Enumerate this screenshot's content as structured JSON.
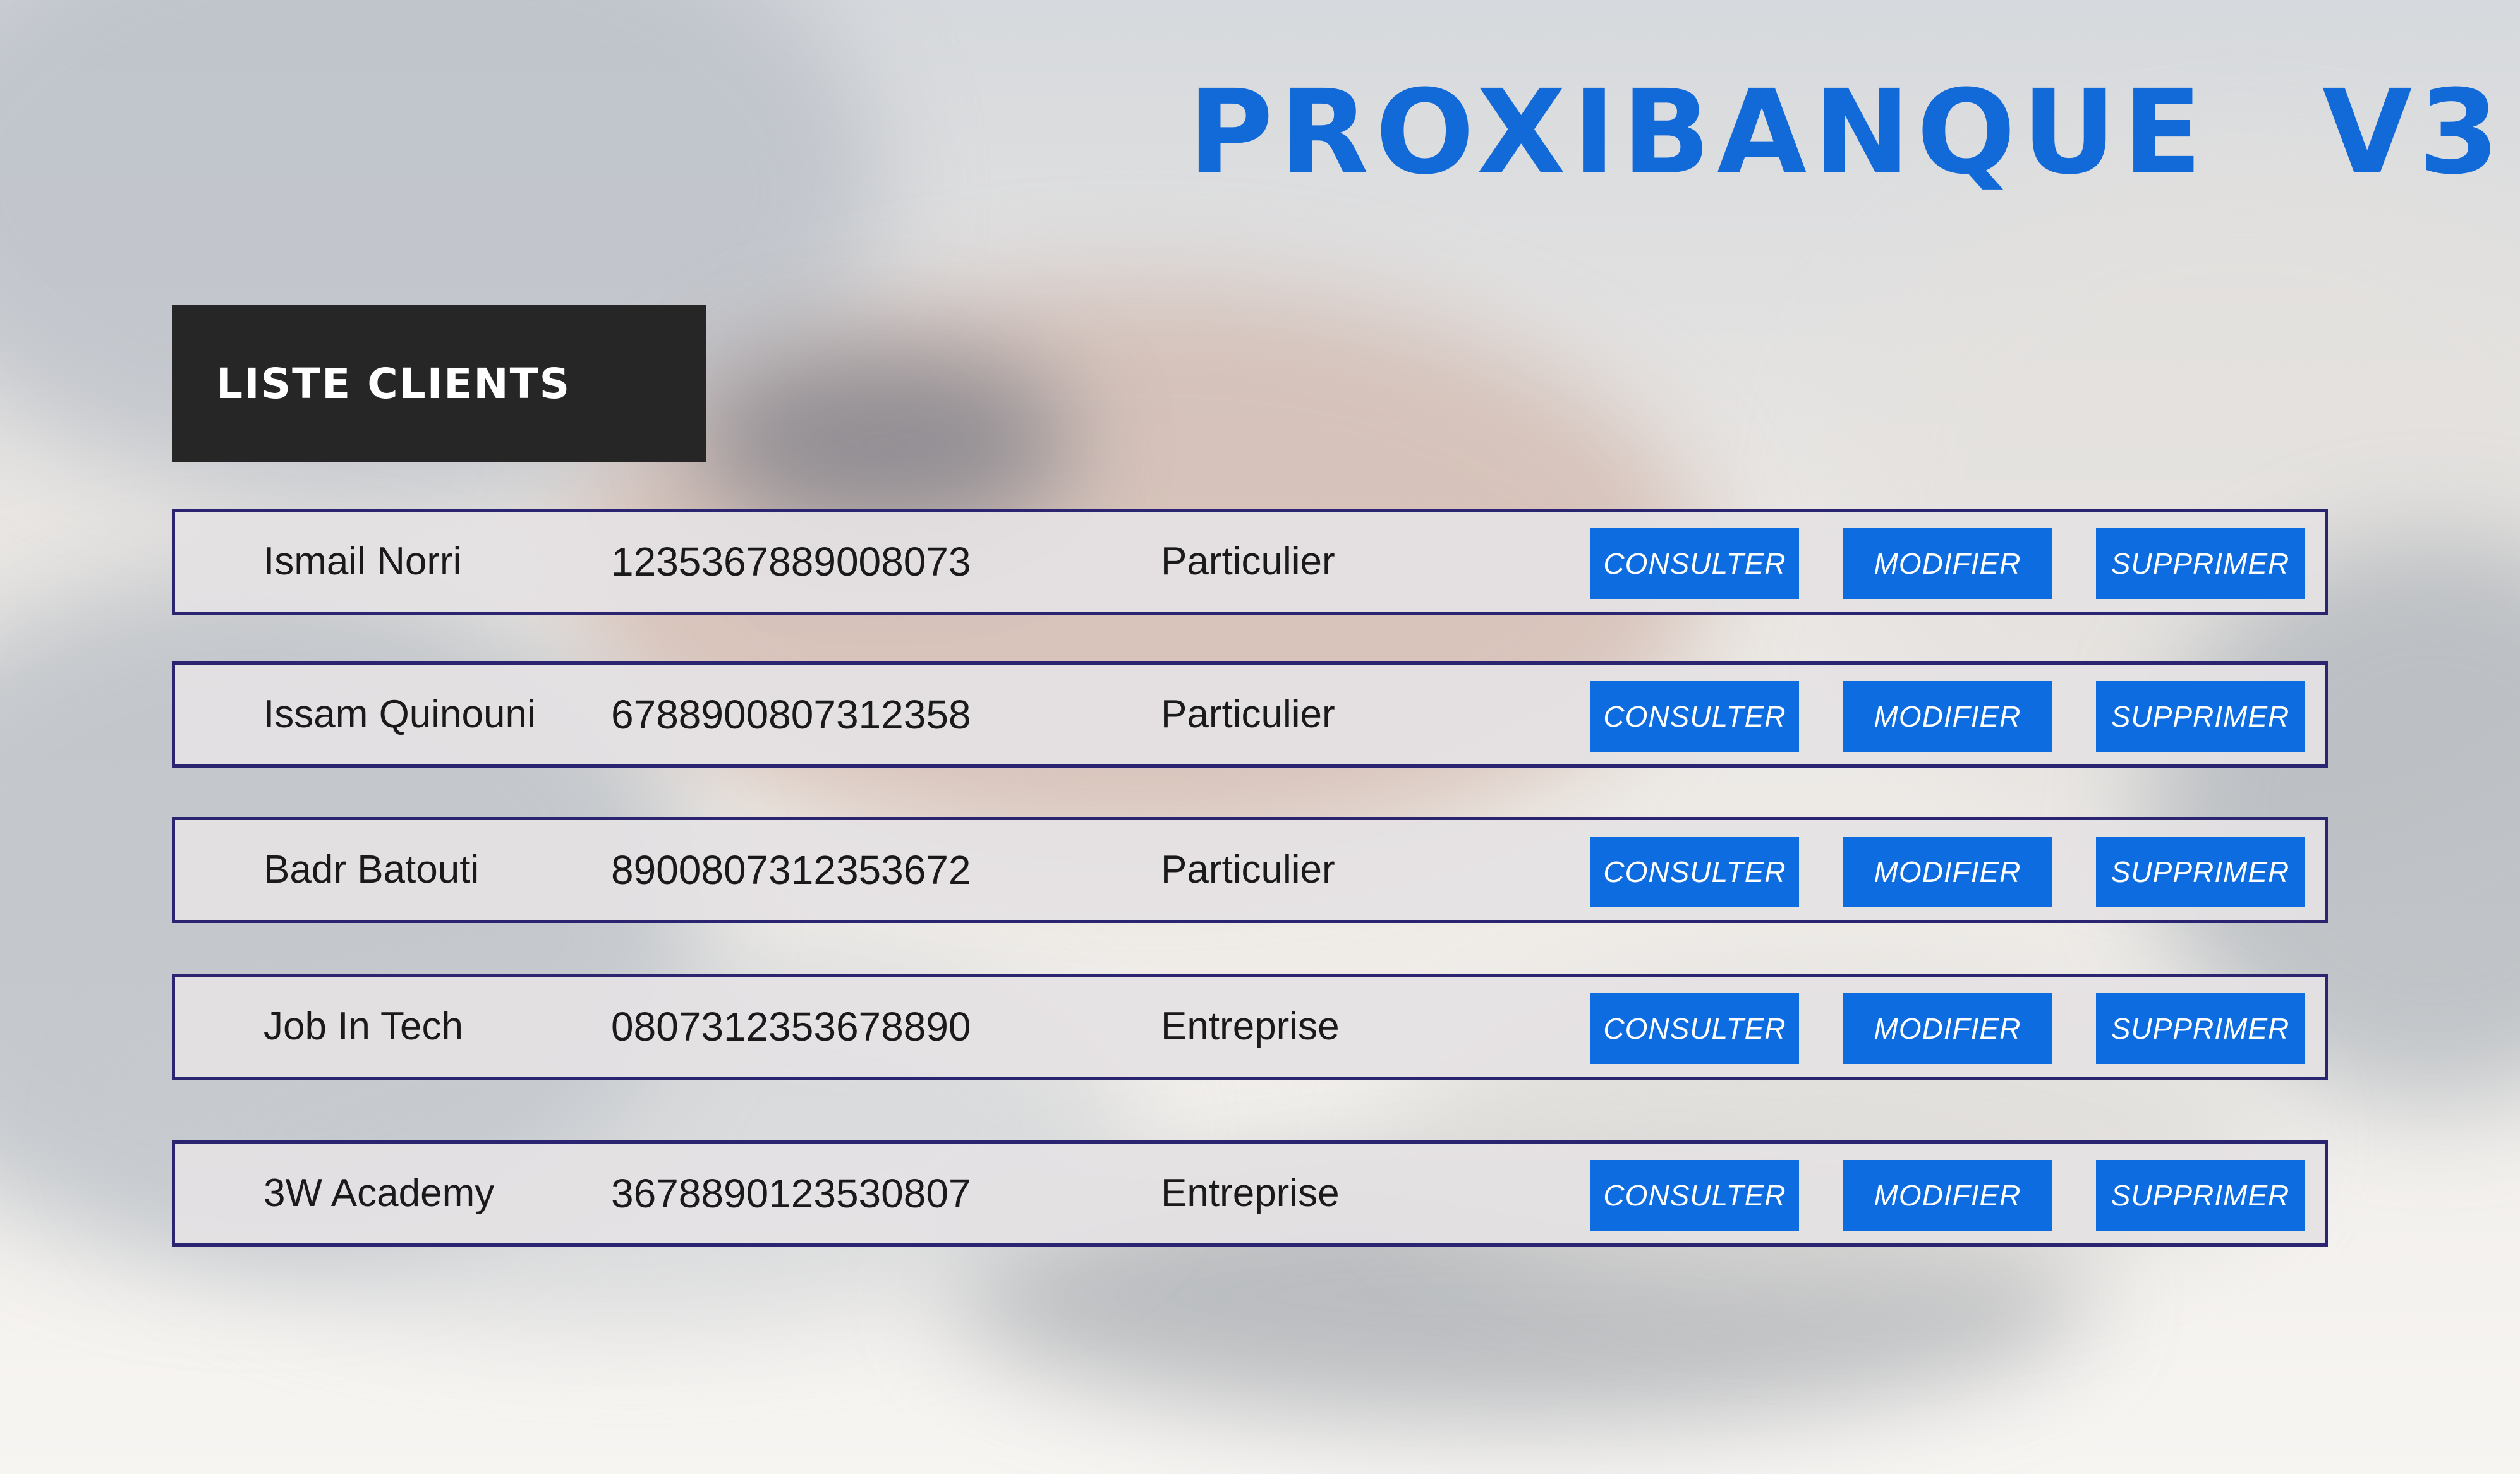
{
  "app": {
    "title": "PROXIBANQUE",
    "version": "V3"
  },
  "section": {
    "title": "LISTE CLIENTS"
  },
  "actions": {
    "consult_label": "CONSULTER",
    "modify_label": "MODIFIER",
    "delete_label": "SUPPRIMER"
  },
  "clients": [
    {
      "name": "Ismail Norri",
      "account": "1235367889008073",
      "type": "Particulier"
    },
    {
      "name": "Issam Quinouni",
      "account": "6788900807312358",
      "type": "Particulier"
    },
    {
      "name": "Badr Batouti",
      "account": "8900807312353672",
      "type": "Particulier"
    },
    {
      "name": "Job In Tech",
      "account": "0807312353678890",
      "type": "Entreprise"
    },
    {
      "name": "3W Academy",
      "account": "3678890123530807",
      "type": "Entreprise"
    }
  ],
  "colors": {
    "accent": "#1269d8",
    "button": "#0d6ce0",
    "header_bg": "#262626",
    "row_border": "#2b2470"
  }
}
